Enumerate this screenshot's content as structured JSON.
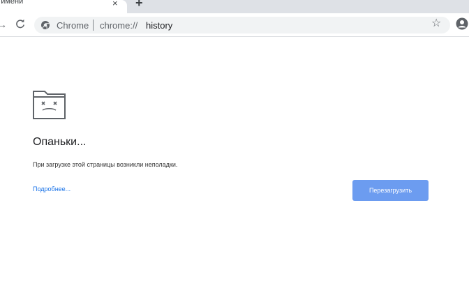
{
  "tab": {
    "title": "Без имени",
    "close_glyph": "×",
    "new_tab_glyph": "+"
  },
  "toolbar": {
    "forward_glyph": "→",
    "chip_label": "Chrome",
    "url_scheme": "chrome://",
    "url_host": "history",
    "star_glyph": "☆"
  },
  "error": {
    "title": "Опаньки...",
    "message": "При загрузке этой страницы возникли неполадки.",
    "learn_more": "Подробнее...",
    "reload_label": "Перезагрузить"
  },
  "colors": {
    "tabstrip": "#dee1e6",
    "omnibox": "#f1f3f4",
    "link": "#1a73e8",
    "button": "#6c9cf0"
  }
}
